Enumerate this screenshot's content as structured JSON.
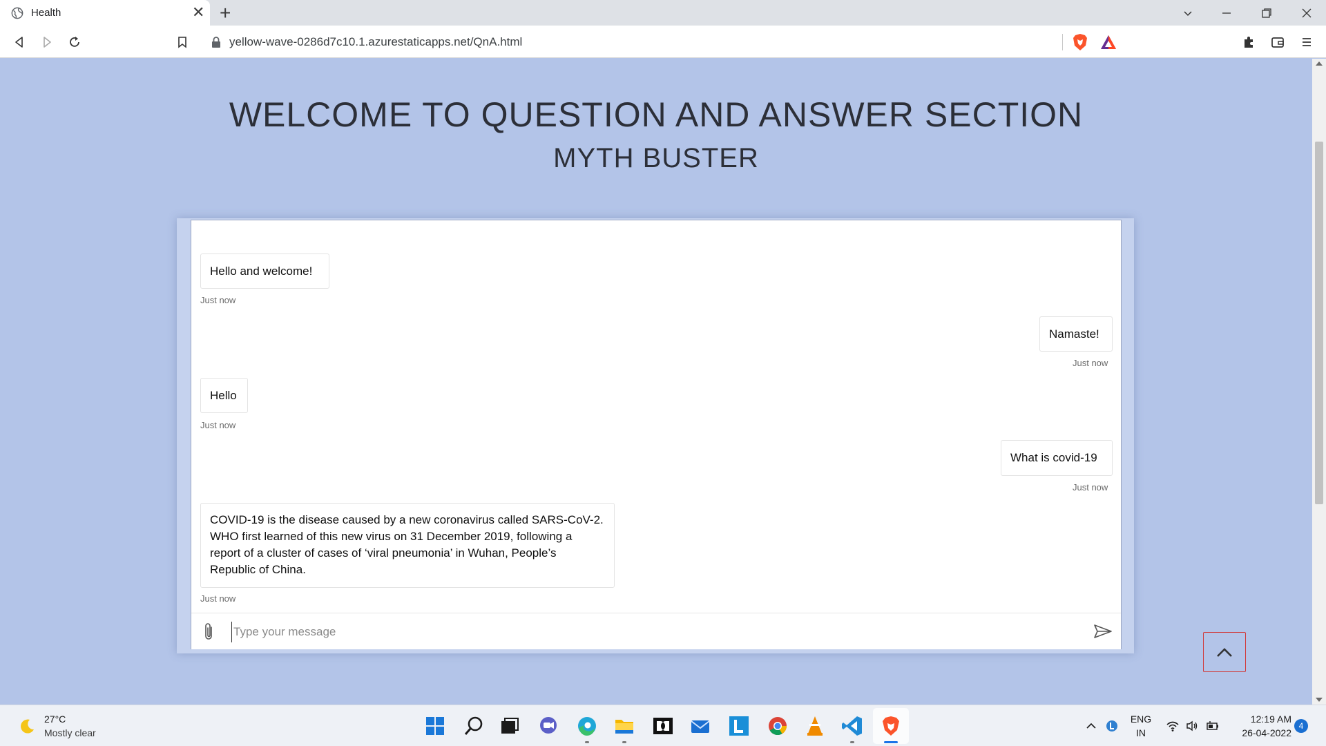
{
  "browser": {
    "tab_title": "Health",
    "url": "yellow-wave-0286d7c10.1.azurestaticapps.net/QnA.html"
  },
  "page": {
    "title": "WELCOME TO QUESTION AND ANSWER SECTION",
    "subtitle": "MYTH BUSTER"
  },
  "chat": {
    "messages": [
      {
        "from": "bot",
        "text": "Hello and welcome!",
        "time": "Just now"
      },
      {
        "from": "user",
        "text": "Namaste!",
        "time": "Just now"
      },
      {
        "from": "bot",
        "text": "Hello",
        "time": "Just now"
      },
      {
        "from": "user",
        "text": "What is covid-19",
        "time": "Just now"
      },
      {
        "from": "bot",
        "text": "COVID-19 is the disease caused by a new coronavirus called SARS-CoV-2.  WHO first learned of this new virus on 31 December 2019, following a report of a cluster of cases of ‘viral pneumonia’ in Wuhan, People’s Republic of China.",
        "time": "Just now"
      }
    ],
    "input_placeholder": "Type your message"
  },
  "taskbar": {
    "weather_temp": "27°C",
    "weather_desc": "Mostly clear",
    "lang_top": "ENG",
    "lang_bottom": "IN",
    "time": "12:19 AM",
    "date": "26-04-2022",
    "notification_count": "4"
  },
  "colors": {
    "page_bg": "#b3c4e8",
    "brave_orange": "#fb542b",
    "accent_blue": "#1a73e8",
    "to_top_border": "#d13b3b"
  }
}
